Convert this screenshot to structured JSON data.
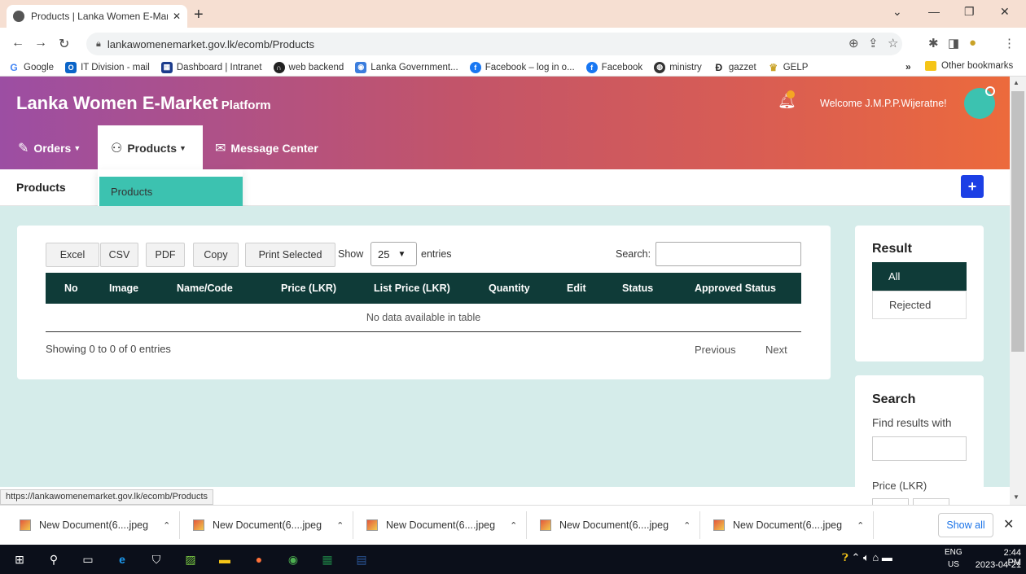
{
  "browser": {
    "tab_title": "Products | Lanka Women E-Mark",
    "tab_close": "✕",
    "new_tab": "+",
    "url": "lankawomenemarket.gov.lk/ecomb/Products",
    "status_url": "https://lankawomenemarket.gov.lk/ecomb/Products",
    "bookmarks": [
      {
        "label": "Google"
      },
      {
        "label": "IT Division - mail"
      },
      {
        "label": "Dashboard | Intranet"
      },
      {
        "label": "web backend"
      },
      {
        "label": "Lanka Government..."
      },
      {
        "label": "Facebook – log in o..."
      },
      {
        "label": "Facebook"
      },
      {
        "label": "ministry"
      },
      {
        "label": "gazzet"
      },
      {
        "label": "GELP"
      }
    ],
    "bookmarks_more": "»",
    "other_bookmarks": "Other bookmarks"
  },
  "header": {
    "brand": "Lanka Women E-Market",
    "brand_sub": "Platform",
    "welcome": "Welcome J.M.P.P.Wijeratne!"
  },
  "nav": {
    "orders": "Orders",
    "products": "Products",
    "message_center": "Message Center",
    "dropdown_item": "Products"
  },
  "page": {
    "title": "Products",
    "add_button": "+"
  },
  "toolbar": {
    "excel": "Excel",
    "csv": "CSV",
    "pdf": "PDF",
    "copy": "Copy",
    "print_selected": "Print Selected",
    "show_label": "Show",
    "show_value": "25",
    "entries_label": "entries",
    "search_label": "Search:"
  },
  "table": {
    "columns": [
      "No",
      "Image",
      "Name/Code",
      "Price (LKR)",
      "List Price (LKR)",
      "Quantity",
      "Edit",
      "Status",
      "Approved Status"
    ],
    "empty_message": "No data available in table",
    "info": "Showing 0 to 0 of 0 entries",
    "previous": "Previous",
    "next": "Next"
  },
  "result": {
    "title": "Result",
    "options": [
      "All",
      "Rejected"
    ]
  },
  "search_panel": {
    "title": "Search",
    "hint": "Find results with",
    "price_label": "Price (LKR)"
  },
  "downloads": {
    "items": [
      "New Document(6....jpeg",
      "New Document(6....jpeg",
      "New Document(6....jpeg",
      "New Document(6....jpeg",
      "New Document(6....jpeg"
    ],
    "show_all": "Show all",
    "close": "✕"
  },
  "taskbar": {
    "lang_top": "ENG",
    "lang_bottom": "US",
    "time": "2:44 PM",
    "date": "2023-04-21"
  },
  "colors": {
    "header_start": "#9c4ea3",
    "header_end": "#ec6a3c",
    "teal": "#3cc2b0",
    "table_header": "#0f3b38",
    "add_button": "#1c3fe5",
    "content_bg": "#d5ecea"
  }
}
